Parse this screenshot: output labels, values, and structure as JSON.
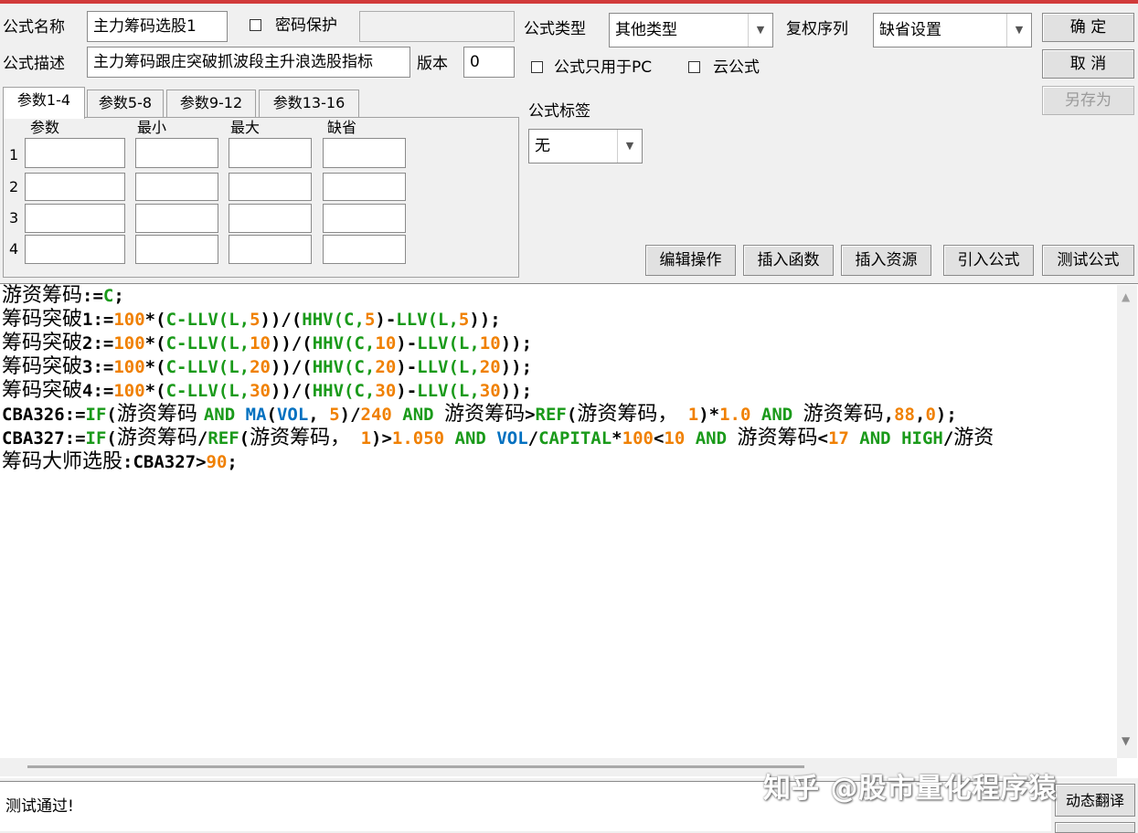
{
  "form": {
    "name_label": "公式名称",
    "name_value": "主力筹码选股1",
    "password_label": "密码保护",
    "password_value": "",
    "desc_label": "公式描述",
    "desc_value": "主力筹码跟庄突破抓波段主升浪选股指标",
    "version_label": "版本",
    "version_value": "0",
    "type_label": "公式类型",
    "type_value": "其他类型",
    "rights_label": "复权序列",
    "rights_value": "缺省设置",
    "pc_only_label": "公式只用于PC",
    "cloud_label": "云公式",
    "tag_label": "公式标签",
    "tag_value": "无"
  },
  "buttons": {
    "ok": "确  定",
    "cancel": "取  消",
    "save_as": "另存为",
    "edit_ops": "编辑操作",
    "insert_func": "插入函数",
    "insert_res": "插入资源",
    "import_formula": "引入公式",
    "test_formula": "测试公式",
    "translate": "动态翻译"
  },
  "params": {
    "tabs": [
      "参数1-4",
      "参数5-8",
      "参数9-12",
      "参数13-16"
    ],
    "headers": [
      "参数",
      "最小",
      "最大",
      "缺省"
    ],
    "rows": [
      "1",
      "2",
      "3",
      "4"
    ]
  },
  "code_colors": {
    "default": "#000000",
    "func": "#1a9a1a",
    "num": "#f08000",
    "kw": "#0070c0"
  },
  "code": [
    [
      [
        "游资筹码",
        "cjk"
      ],
      [
        ":=",
        "d"
      ],
      [
        "C",
        "f"
      ],
      [
        ";",
        "d"
      ]
    ],
    [
      [
        "筹码突破",
        "cjk"
      ],
      [
        "1:=",
        "d"
      ],
      [
        "100",
        "n"
      ],
      [
        "*(",
        "d"
      ],
      [
        "C-LLV(L,",
        "f"
      ],
      [
        "5",
        "n"
      ],
      [
        "))/(",
        "d"
      ],
      [
        "HHV(C,",
        "f"
      ],
      [
        "5",
        "n"
      ],
      [
        ")-",
        "d"
      ],
      [
        "LLV(L,",
        "f"
      ],
      [
        "5",
        "n"
      ],
      [
        "));",
        "d"
      ]
    ],
    [
      [
        "筹码突破",
        "cjk"
      ],
      [
        "2:=",
        "d"
      ],
      [
        "100",
        "n"
      ],
      [
        "*(",
        "d"
      ],
      [
        "C-LLV(L,",
        "f"
      ],
      [
        "10",
        "n"
      ],
      [
        "))/(",
        "d"
      ],
      [
        "HHV(C,",
        "f"
      ],
      [
        "10",
        "n"
      ],
      [
        ")-",
        "d"
      ],
      [
        "LLV(L,",
        "f"
      ],
      [
        "10",
        "n"
      ],
      [
        "));",
        "d"
      ]
    ],
    [
      [
        "筹码突破",
        "cjk"
      ],
      [
        "3:=",
        "d"
      ],
      [
        "100",
        "n"
      ],
      [
        "*(",
        "d"
      ],
      [
        "C-LLV(L,",
        "f"
      ],
      [
        "20",
        "n"
      ],
      [
        "))/(",
        "d"
      ],
      [
        "HHV(C,",
        "f"
      ],
      [
        "20",
        "n"
      ],
      [
        ")-",
        "d"
      ],
      [
        "LLV(L,",
        "f"
      ],
      [
        "20",
        "n"
      ],
      [
        "));",
        "d"
      ]
    ],
    [
      [
        "筹码突破",
        "cjk"
      ],
      [
        "4:=",
        "d"
      ],
      [
        "100",
        "n"
      ],
      [
        "*(",
        "d"
      ],
      [
        "C-LLV(L,",
        "f"
      ],
      [
        "30",
        "n"
      ],
      [
        "))/(",
        "d"
      ],
      [
        "HHV(C,",
        "f"
      ],
      [
        "30",
        "n"
      ],
      [
        ")-",
        "d"
      ],
      [
        "LLV(L,",
        "f"
      ],
      [
        "30",
        "n"
      ],
      [
        "));",
        "d"
      ]
    ],
    [
      [
        "CBA326:=",
        "d"
      ],
      [
        "IF",
        "f"
      ],
      [
        "(",
        "d"
      ],
      [
        "游资筹码 ",
        "cjk"
      ],
      [
        "AND ",
        "f"
      ],
      [
        "MA",
        "k"
      ],
      [
        "(",
        "d"
      ],
      [
        "VOL",
        "k"
      ],
      [
        ", ",
        "d"
      ],
      [
        "5",
        "n"
      ],
      [
        ")/",
        "d"
      ],
      [
        "240",
        "n"
      ],
      [
        " AND ",
        "f"
      ],
      [
        "游资筹码",
        "cjk"
      ],
      [
        ">",
        "d"
      ],
      [
        "REF",
        "f"
      ],
      [
        "(",
        "d"
      ],
      [
        "游资筹码，",
        "cjk"
      ],
      [
        " 1",
        "n"
      ],
      [
        ")*",
        "d"
      ],
      [
        "1.0",
        "n"
      ],
      [
        " AND ",
        "f"
      ],
      [
        "游资筹码",
        "cjk"
      ],
      [
        ",",
        "d"
      ],
      [
        "88",
        "n"
      ],
      [
        ",",
        "d"
      ],
      [
        "0",
        "n"
      ],
      [
        ");",
        "d"
      ]
    ],
    [
      [
        "CBA327:=",
        "d"
      ],
      [
        "IF",
        "f"
      ],
      [
        "(",
        "d"
      ],
      [
        "游资筹码",
        "cjk"
      ],
      [
        "/",
        "d"
      ],
      [
        "REF",
        "f"
      ],
      [
        "(",
        "d"
      ],
      [
        "游资筹码，",
        "cjk"
      ],
      [
        " 1",
        "n"
      ],
      [
        ")>",
        "d"
      ],
      [
        "1.050",
        "n"
      ],
      [
        " AND ",
        "f"
      ],
      [
        "VOL",
        "k"
      ],
      [
        "/",
        "d"
      ],
      [
        "CAPITAL",
        "f"
      ],
      [
        "*",
        "d"
      ],
      [
        "100",
        "n"
      ],
      [
        "<",
        "d"
      ],
      [
        "10",
        "n"
      ],
      [
        " AND ",
        "f"
      ],
      [
        "游资筹码",
        "cjk"
      ],
      [
        "<",
        "d"
      ],
      [
        "17",
        "n"
      ],
      [
        " AND ",
        "f"
      ],
      [
        "HIGH",
        "f"
      ],
      [
        "/",
        "d"
      ],
      [
        "游资",
        "cjk"
      ]
    ],
    [
      [
        "筹码大师选股",
        "cjk"
      ],
      [
        ":CBA327>",
        "d"
      ],
      [
        "90",
        "n"
      ],
      [
        ";",
        "d"
      ]
    ]
  ],
  "status": {
    "message": "测试通过!"
  },
  "watermark": "知乎 @股市量化程序猿"
}
